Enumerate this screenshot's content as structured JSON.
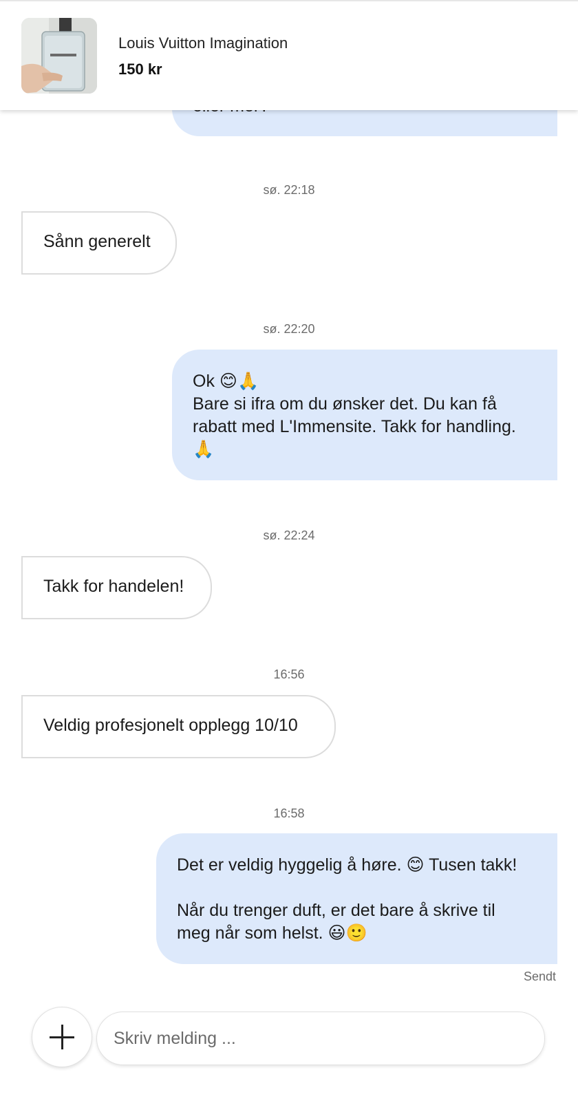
{
  "header": {
    "title": "Louis Vuitton Imagination",
    "price": "150 kr",
    "thumbnail_icon": "perfume-bottle-photo"
  },
  "messages": [
    {
      "direction": "outgoing",
      "text": "eller mer?"
    },
    {
      "timestamp": "sø. 22:18"
    },
    {
      "direction": "incoming",
      "text": "Sånn generelt"
    },
    {
      "timestamp": "sø. 22:20"
    },
    {
      "direction": "outgoing",
      "lines": [
        "Ok 😊🙏",
        "Bare si ifra om du ønsker det. Du kan få",
        "rabatt med L'Immensite. Takk for handling.",
        "🙏"
      ]
    },
    {
      "timestamp": "sø. 22:24"
    },
    {
      "direction": "incoming",
      "text": "Takk for handelen!"
    },
    {
      "timestamp": "16:56"
    },
    {
      "direction": "incoming",
      "text": "Veldig profesjonelt opplegg 10/10"
    },
    {
      "timestamp": "16:58"
    },
    {
      "direction": "outgoing",
      "lines": [
        "Det er veldig hyggelig å høre. 😊 Tusen takk!",
        "",
        "Når du trenger duft, er det bare å skrive til",
        "meg når som helst. 😃🙂"
      ]
    }
  ],
  "status": "Sendt",
  "composer": {
    "placeholder": "Skriv melding ...",
    "add_icon": "plus-icon"
  },
  "colors": {
    "outgoing_bubble": "#dde9fb",
    "incoming_border": "#dcdcdc",
    "timestamp": "#6b6b6b"
  }
}
